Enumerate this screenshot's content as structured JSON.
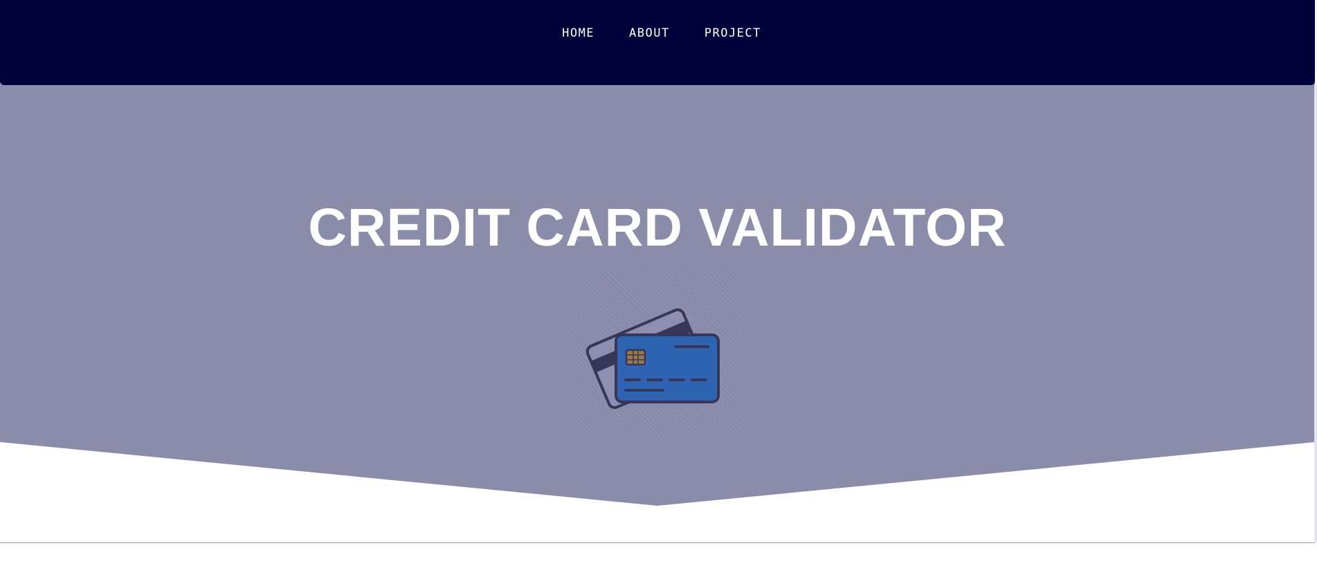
{
  "nav": {
    "links": [
      {
        "label": "HOME"
      },
      {
        "label": "ABOUT"
      },
      {
        "label": "PROJECT"
      }
    ]
  },
  "hero": {
    "title": "CREDIT CARD VALIDATOR",
    "illustration_icon": "credit-cards-icon"
  },
  "colors": {
    "navbar": "#02023a",
    "hero_background": "#8b8caa",
    "title_text": "#ffffff",
    "card_front": "#2f64b3",
    "card_back": "#8d8eb0",
    "card_outline": "#363758",
    "chip": "#9a7a4a"
  }
}
